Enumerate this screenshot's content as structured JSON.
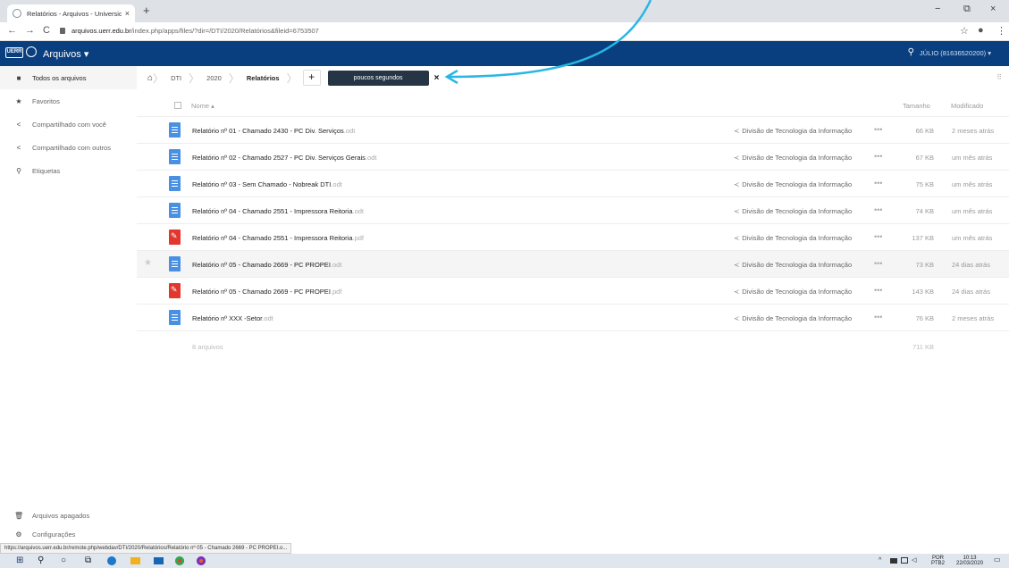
{
  "browser": {
    "tab_title": "Relatórios - Arquivos - Universid...",
    "tab_close": "×",
    "new_tab": "+",
    "win_min": "−",
    "win_max": "⧉",
    "win_close": "×",
    "back": "←",
    "forward": "→",
    "reload": "C",
    "url_host": "arquivos.uerr.edu.br",
    "url_path": "/index.php/apps/files/?dir=/DTI/2020/Relatórios&fileid=6753507",
    "star": "☆",
    "profile": "●",
    "menu": "⋮"
  },
  "header": {
    "logo_text": "UERR",
    "app_title": "Arquivos ▾",
    "search_icon": "⚲",
    "user": "JÚLIO (81636520200) ▾"
  },
  "sidebar": {
    "items": [
      {
        "label": "Todos os arquivos",
        "icon": "■"
      },
      {
        "label": "Favoritos",
        "icon": "★"
      },
      {
        "label": "Compartilhado com você",
        "icon": "<"
      },
      {
        "label": "Compartilhado com outros",
        "icon": "<"
      },
      {
        "label": "Etiquetas",
        "icon": "⚲"
      }
    ],
    "trash": {
      "label": "Arquivos apagados",
      "icon": "🗑"
    },
    "settings": {
      "label": "Configurações",
      "icon": "⚙"
    }
  },
  "breadcrumb": {
    "home_icon": "⌂",
    "items": [
      "DTI",
      "2020",
      "Relatórios"
    ],
    "sep": "〉",
    "plus": "+",
    "toast": "poucos segundos",
    "toast_close": "×",
    "grid_icon": "⠿"
  },
  "table": {
    "headers": {
      "name": "Nome ▴",
      "size": "Tamanho",
      "modified": "Modificado"
    },
    "share_icon": "≺",
    "more": "•••",
    "star": "★",
    "rows": [
      {
        "name": "Relatório nº 01 - Chamado 2430 - PC Div. Serviços",
        "ext": ".odt",
        "type": "doc",
        "share": "Divisão de Tecnologia da Informação",
        "size": "66 KB",
        "modified": "2 meses atrás"
      },
      {
        "name": "Relatório nº 02 - Chamado 2527 - PC Div. Serviços Gerais",
        "ext": ".odt",
        "type": "doc",
        "share": "Divisão de Tecnologia da Informação",
        "size": "67 KB",
        "modified": "um mês atrás"
      },
      {
        "name": "Relatório nº 03 - Sem Chamado - Nobreak DTI",
        "ext": ".odt",
        "type": "doc",
        "share": "Divisão de Tecnologia da Informação",
        "size": "75 KB",
        "modified": "um mês atrás"
      },
      {
        "name": "Relatório nº 04 - Chamado 2551 - Impressora Reitoria",
        "ext": ".odt",
        "type": "doc",
        "share": "Divisão de Tecnologia da Informação",
        "size": "74 KB",
        "modified": "um mês atrás"
      },
      {
        "name": "Relatório nº 04 - Chamado 2551 - Impressora Reitoria",
        "ext": ".pdf",
        "type": "pdf",
        "share": "Divisão de Tecnologia da Informação",
        "size": "137 KB",
        "modified": "um mês atrás"
      },
      {
        "name": "Relatório nº 05 - Chamado 2669 - PC PROPEI",
        "ext": ".odt",
        "type": "doc",
        "share": "Divisão de Tecnologia da Informação",
        "size": "73 KB",
        "modified": "24 dias atrás"
      },
      {
        "name": "Relatório nº 05 - Chamado 2669 - PC PROPEI",
        "ext": ".pdf",
        "type": "pdf",
        "share": "Divisão de Tecnologia da Informação",
        "size": "143 KB",
        "modified": "24 dias atrás"
      },
      {
        "name": "Relatório nº XXX -Setor",
        "ext": ".odt",
        "type": "doc",
        "share": "Divisão de Tecnologia da Informação",
        "size": "76 KB",
        "modified": "2 meses atrás"
      }
    ],
    "summary_count": "8 arquivos",
    "summary_total": "711 KB"
  },
  "status_url": "https://arquivos.uerr.edu.br/remote.php/webdav/DTI/2020/Relatórios/Relatório nº 05 - Chamado 2669 - PC PROPEI.o...",
  "taskbar": {
    "start": "⊞",
    "search": "⚲",
    "cortana": "○",
    "taskview": "⧉",
    "tray_up": "^",
    "lang_top": "POR",
    "lang_bottom": "PTB2",
    "time": "10:13",
    "date": "22/03/2020",
    "notif": "▭"
  },
  "colors": {
    "header": "#0a3f7f",
    "doc_icon": "#4a90e2",
    "pdf_icon": "#e2362f",
    "toast": "#253546",
    "arrow": "#29b6e6"
  }
}
